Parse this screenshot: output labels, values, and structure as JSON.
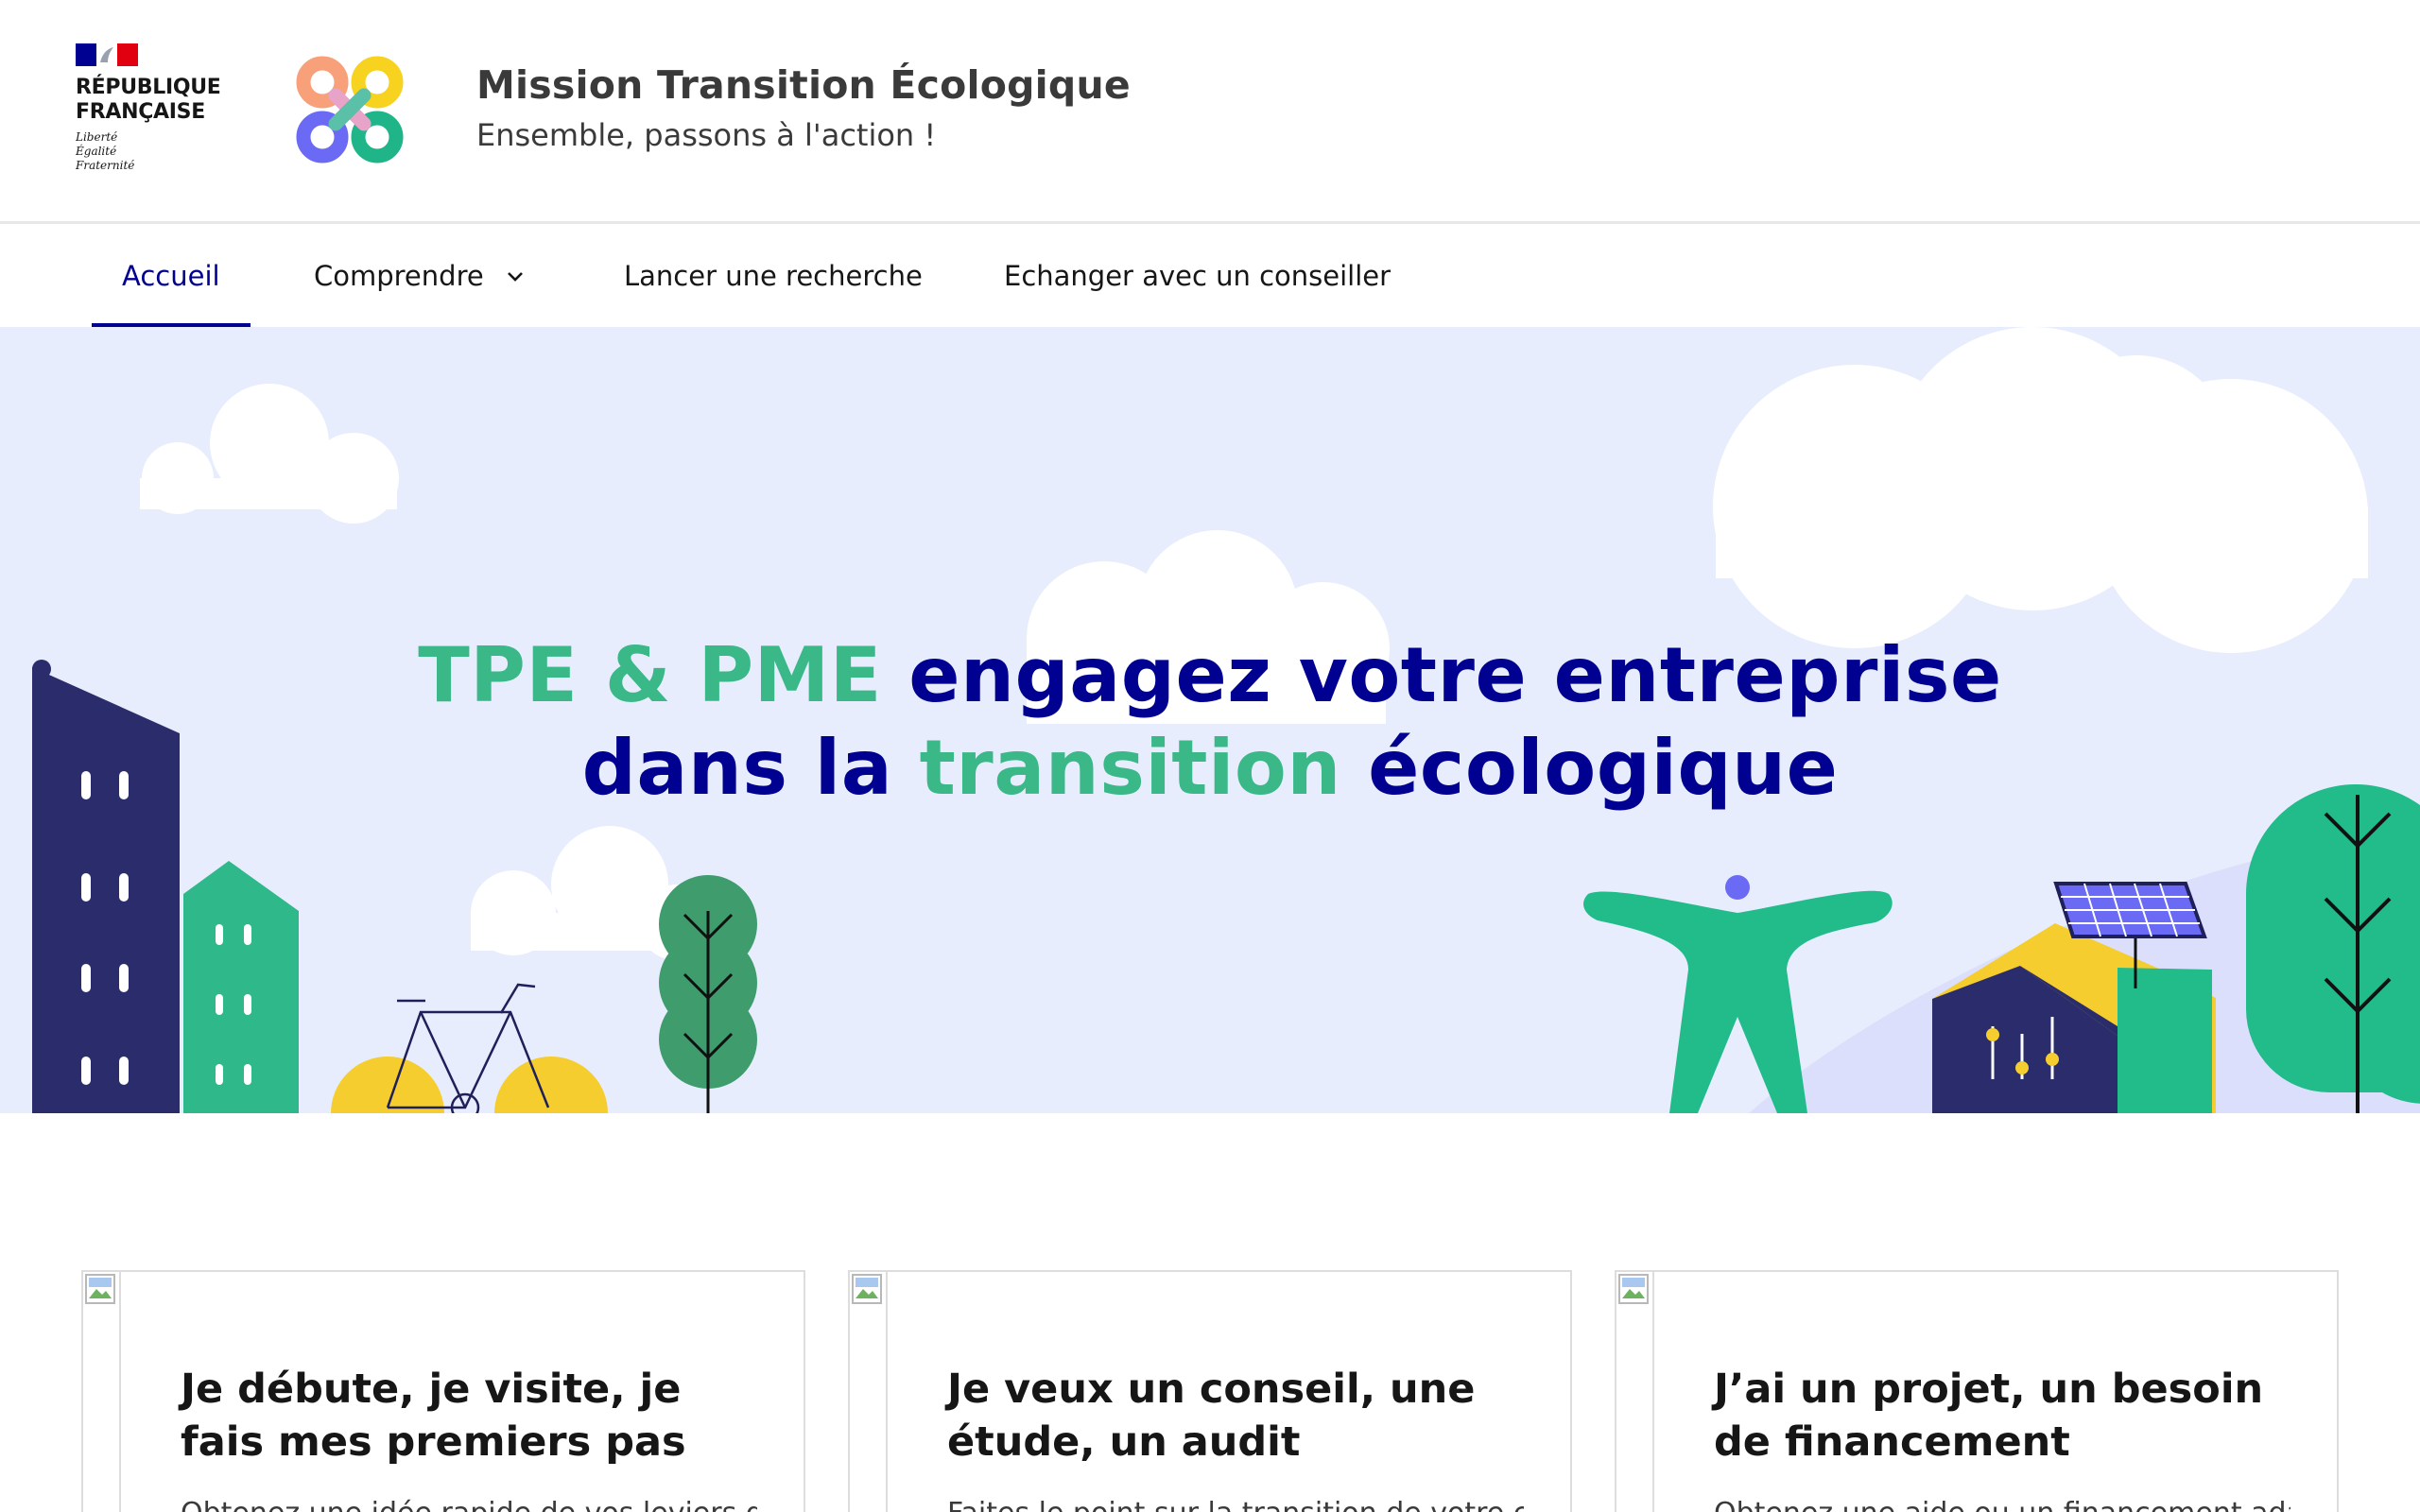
{
  "header": {
    "republique_lines": [
      "RÉPUBLIQUE",
      "FRANÇAISE"
    ],
    "motto_lines": [
      "Liberté",
      "Égalité",
      "Fraternité"
    ],
    "site_title": "Mission Transition Écologique",
    "tagline": "Ensemble, passons à l'action !"
  },
  "nav": {
    "items": [
      {
        "label": "Accueil",
        "active": true
      },
      {
        "label": "Comprendre",
        "has_dropdown": true
      },
      {
        "label": "Lancer une recherche"
      },
      {
        "label": "Echanger avec un conseiller"
      }
    ]
  },
  "hero": {
    "line1_highlight": "TPE & PME",
    "line1_rest": " engagez votre entreprise",
    "line2_start": "dans la ",
    "line2_highlight": "transition",
    "line2_end": " écologique"
  },
  "cards": [
    {
      "title": "Je débute, je visite, je fais mes premiers pas",
      "desc": "Obtenez une idée rapide de vos leviers d'actions"
    },
    {
      "title": "Je veux un conseil, une étude, un audit",
      "desc": "Faites le point sur la transition de votre entreprise"
    },
    {
      "title": "J’ai un projet, un besoin de financement",
      "desc": "Obtenez une aide ou un financement adapté"
    }
  ],
  "colors": {
    "primary_blue": "#000091",
    "accent_green": "#3ab888",
    "hero_background": "#e8edfd",
    "flag_blue": "#000091",
    "flag_red": "#e1000f"
  },
  "icons": [
    "marianne-icon",
    "mte-infinity-logo-icon",
    "chevron-down-icon",
    "broken-image-icon"
  ]
}
